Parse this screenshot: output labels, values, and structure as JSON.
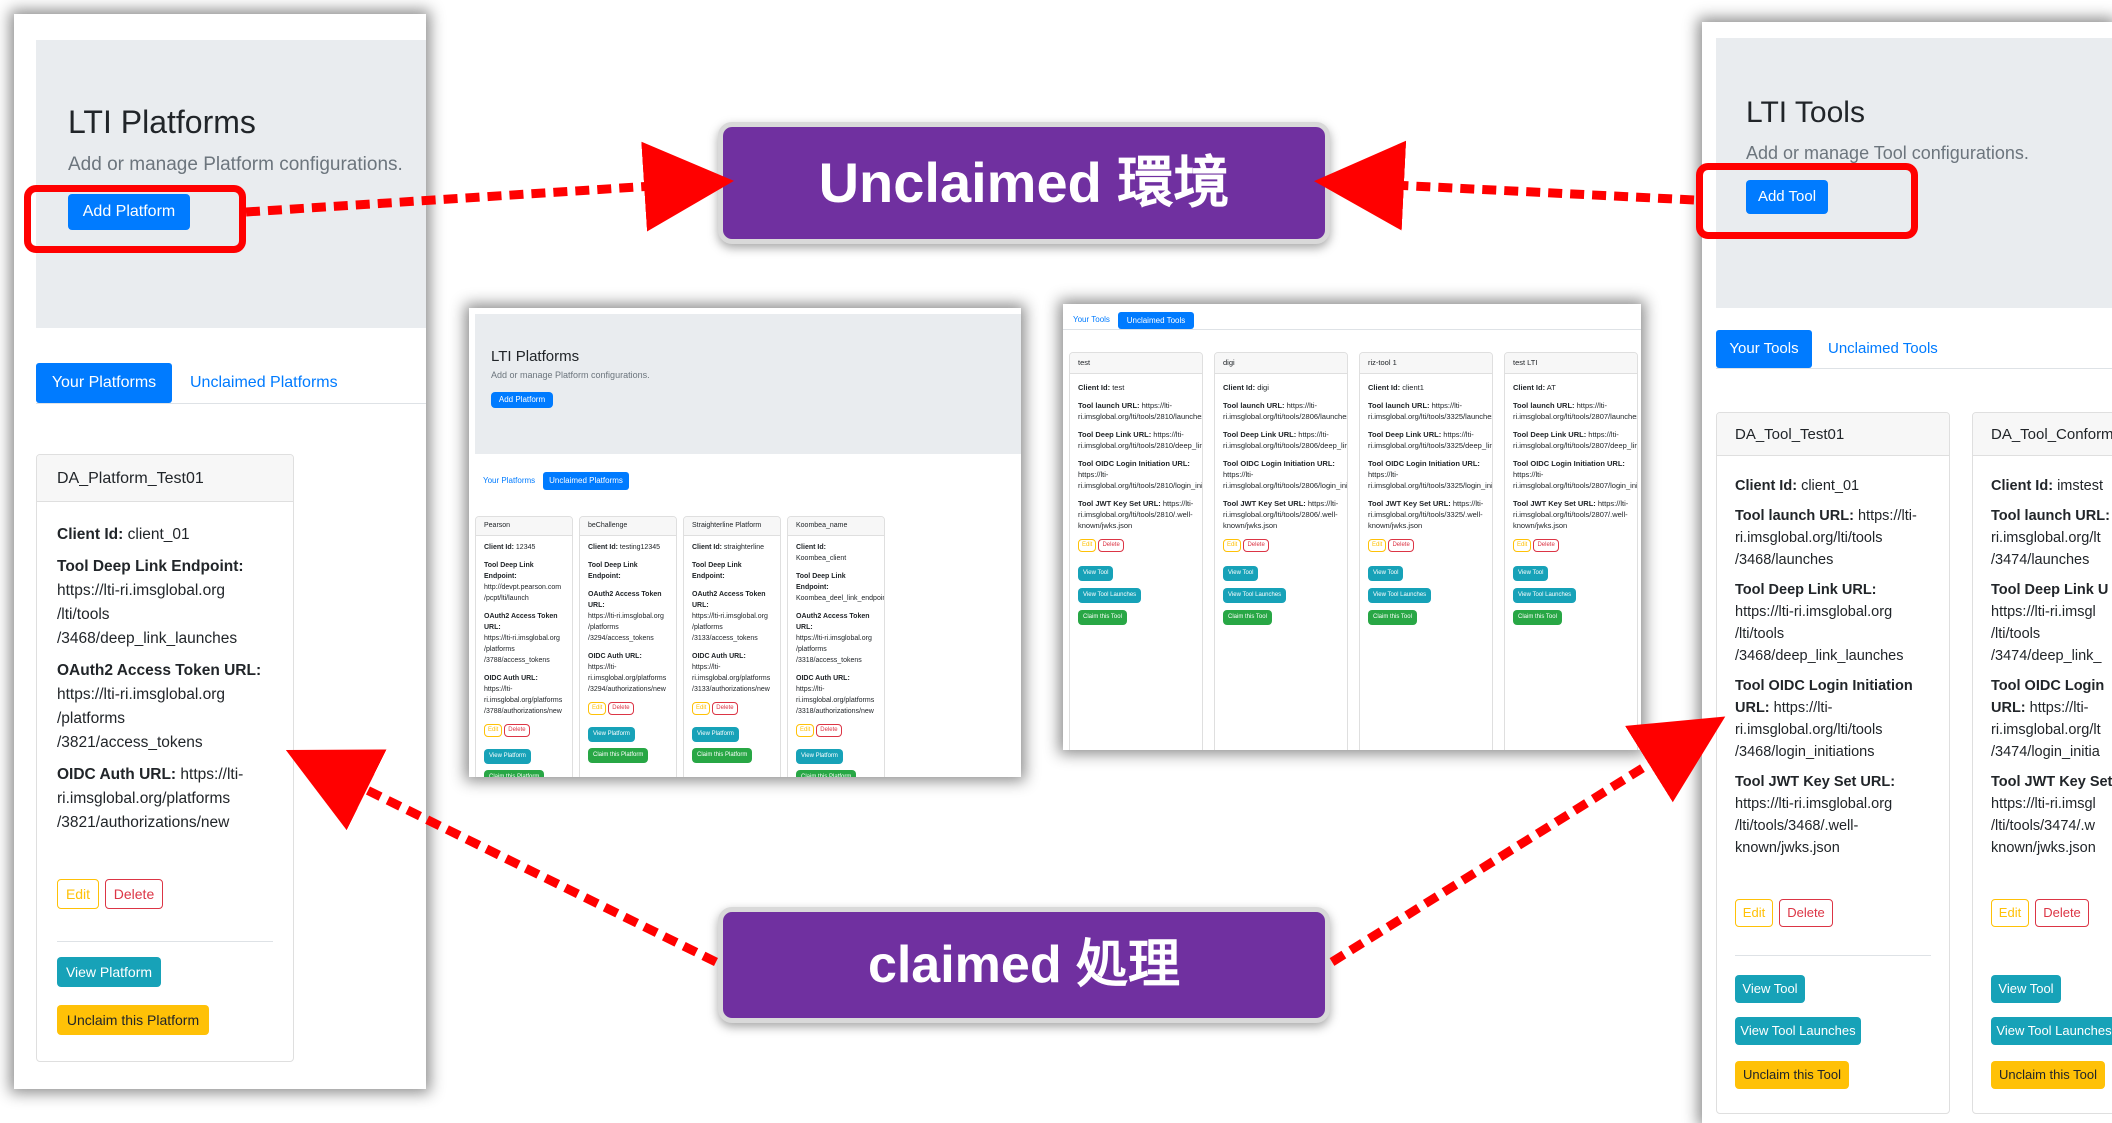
{
  "platforms": {
    "title": "LTI Platforms",
    "subtitle": "Add or manage Platform configurations.",
    "add_label": "Add Platform",
    "tabs": [
      "Your Platforms",
      "Unclaimed Platforms"
    ],
    "card": {
      "name": "DA_Platform_Test01",
      "client_id_label": "Client Id:",
      "client_id": "client_01",
      "deep_link_label": "Tool Deep Link Endpoint:",
      "deep_link_lines": [
        "https://lti-ri.imsglobal.org",
        "/lti/tools",
        "/3468/deep_link_launches"
      ],
      "oauth_label": "OAuth2 Access Token URL:",
      "oauth_lines": [
        "https://lti-ri.imsglobal.org",
        "/platforms",
        "/3821/access_tokens"
      ],
      "oidc_label": "OIDC Auth URL:",
      "oidc_first": "https://lti-",
      "oidc_lines": [
        "ri.imsglobal.org/platforms",
        "/3821/authorizations/new"
      ],
      "edit": "Edit",
      "delete": "Delete",
      "view": "View Platform",
      "unclaim": "Unclaim this Platform"
    }
  },
  "tools": {
    "title": "LTI Tools",
    "subtitle": "Add or manage Tool configurations.",
    "add_label": "Add Tool",
    "tabs": [
      "Your Tools",
      "Unclaimed Tools"
    ],
    "card1": {
      "name": "DA_Tool_Test01",
      "client_id_label": "Client Id:",
      "client_id": "client_01",
      "launch_label": "Tool launch URL:",
      "launch_first": "https://lti-",
      "launch_lines": [
        "ri.imsglobal.org/lti/tools",
        "/3468/launches"
      ],
      "deep_label": "Tool Deep Link URL:",
      "deep_lines": [
        "https://lti-ri.imsglobal.org",
        "/lti/tools",
        "/3468/deep_link_launches"
      ],
      "oidc_label": "Tool OIDC Login Initiation",
      "oidc_label2": "URL:",
      "oidc_first": "https://lti-",
      "oidc_lines": [
        "ri.imsglobal.org/lti/tools",
        "/3468/login_initiations"
      ],
      "jwks_label": "Tool JWT Key Set URL:",
      "jwks_lines": [
        "https://lti-ri.imsglobal.org",
        "/lti/tools/3468/.well-",
        "known/jwks.json"
      ],
      "edit": "Edit",
      "delete": "Delete",
      "view": "View Tool",
      "launches": "View Tool Launches",
      "unclaim": "Unclaim this Tool"
    },
    "card2": {
      "name": "DA_Tool_Conform",
      "client_id_label": "Client Id:",
      "client_id": "imstest",
      "launch_label": "Tool launch URL:",
      "launch_lines": [
        "ri.imsglobal.org/lt",
        "/3474/launches"
      ],
      "deep_label": "Tool Deep Link U",
      "deep_lines": [
        "https://lti-ri.imsgl",
        "/lti/tools",
        "/3474/deep_link_"
      ],
      "oidc_label": "Tool OIDC Login",
      "oidc_label2": "URL:",
      "oidc_first": "https://lti-",
      "oidc_lines": [
        "ri.imsglobal.org/lt",
        "/3474/login_initia"
      ],
      "jwks_label": "Tool JWT Key Set",
      "jwks_lines": [
        "https://lti-ri.imsgl",
        "/lti/tools/3474/.w",
        "known/jwks.json"
      ],
      "edit": "Edit",
      "delete": "Delete",
      "view": "View Tool",
      "launches": "View Tool Launches",
      "unclaim": "Unclaim this Tool"
    }
  },
  "mid_platforms": {
    "title": "LTI Platforms",
    "subtitle": "Add or manage Platform configurations.",
    "add_label": "Add Platform",
    "tabs": [
      "Your Platforms",
      "Unclaimed Platforms"
    ],
    "cards": [
      {
        "name": "Pearson",
        "client_id": "12345",
        "deep_lines": [
          "http://devpt.pearson.com",
          "/pcpt/lti/launch"
        ],
        "oauth_lines": [
          "https://lti-ri.imsglobal.org",
          "/platforms",
          "/3788/access_tokens"
        ],
        "oidc_lines": [
          "https://lti-",
          "ri.imsglobal.org/platforms",
          "/3788/authorizations/new"
        ]
      },
      {
        "name": "beChallenge",
        "client_id": "testing12345",
        "deep_lines": [],
        "oauth_lines": [
          "https://lti-ri.imsglobal.org",
          "/platforms",
          "/3294/access_tokens"
        ],
        "oidc_lines": [
          "https://lti-",
          "ri.imsglobal.org/platforms",
          "/3294/authorizations/new"
        ]
      },
      {
        "name": "Straighterline Platform",
        "client_id": "straighterline",
        "deep_lines": [],
        "oauth_lines": [
          "https://lti-ri.imsglobal.org",
          "/platforms",
          "/3133/access_tokens"
        ],
        "oidc_lines": [
          "https://lti-",
          "ri.imsglobal.org/platforms",
          "/3133/authorizations/new"
        ]
      },
      {
        "name": "Koombea_name",
        "client_id": "Koombea_client",
        "deep_lines": [
          "Koombea_deel_link_endpoint"
        ],
        "oauth_lines": [
          "https://lti-ri.imsglobal.org",
          "/platforms",
          "/3318/access_tokens"
        ],
        "oidc_lines": [
          "https://lti-",
          "ri.imsglobal.org/platforms",
          "/3318/authorizations/new"
        ]
      }
    ],
    "labels": {
      "client": "Client Id:",
      "deep": "Tool Deep Link Endpoint:",
      "oauth": "OAuth2 Access Token URL:",
      "oidc": "OIDC Auth URL:",
      "edit": "Edit",
      "delete": "Delete",
      "view": "View Platform",
      "claim": "Claim this Platform"
    }
  },
  "mid_tools": {
    "tabs": [
      "Your Tools",
      "Unclaimed Tools"
    ],
    "cards": [
      {
        "name": "test",
        "client_id": "test",
        "id": "2810"
      },
      {
        "name": "digi",
        "client_id": "digi",
        "id": "2806"
      },
      {
        "name": "riz-tool 1",
        "client_id": "client1",
        "id": "3325"
      },
      {
        "name": "test LTI",
        "client_id": "AT",
        "id": "2807"
      }
    ],
    "labels": {
      "client": "Client Id:",
      "launch": "Tool launch URL:",
      "deep": "Tool Deep Link URL:",
      "oidc": "Tool OIDC Login Initiation URL:",
      "jwks": "Tool JWT Key Set URL:",
      "edit": "Edit",
      "delete": "Delete",
      "view": "View Tool",
      "launches": "View Tool Launches",
      "claim": "Claim this Tool"
    },
    "url_prefix": "https://lti-ri.imsglobal.org/lti/tools/"
  },
  "banners": {
    "unclaimed": "Unclaimed 環境",
    "claimed": "claimed 処理"
  },
  "colors": {
    "arrow": "#ff0000",
    "banner": "#7030a0",
    "primary": "#007bff",
    "info": "#17a2b8",
    "warning": "#ffc107",
    "success": "#28a745",
    "danger": "#dc3545"
  }
}
